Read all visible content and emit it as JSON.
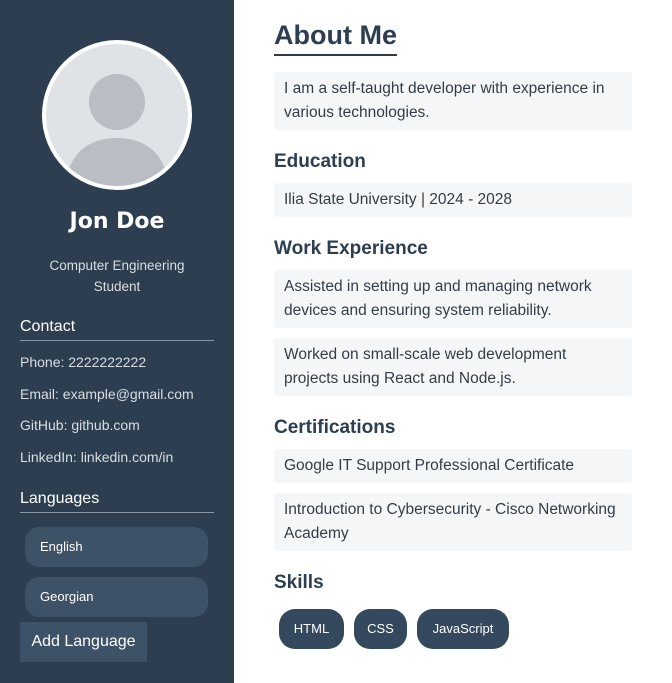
{
  "profile": {
    "name": "Jon Doe",
    "role": "Computer Engineering Student"
  },
  "contact": {
    "heading": "Contact",
    "phone": "Phone: 2222222222",
    "email": "Email: example@gmail.com",
    "github": "GitHub: github.com",
    "linkedin": "LinkedIn: linkedin.com/in"
  },
  "languages": {
    "heading": "Languages",
    "items": [
      "English",
      "Georgian"
    ],
    "add_label": "Add Language"
  },
  "about": {
    "title": "About Me",
    "text": "I am a self-taught developer with experience in various technologies."
  },
  "education": {
    "title": "Education",
    "items": [
      "Ilia State University | 2024 - 2028"
    ]
  },
  "work": {
    "title": "Work Experience",
    "items": [
      "Assisted in setting up and managing network devices and ensuring system reliability.",
      "Worked on small-scale web development projects using React and Node.js."
    ]
  },
  "certifications": {
    "title": "Certifications",
    "items": [
      "Google IT Support Professional Certificate",
      "Introduction to Cybersecurity - Cisco Networking Academy"
    ]
  },
  "skills": {
    "title": "Skills",
    "items": [
      "HTML",
      "CSS",
      "JavaScript"
    ]
  },
  "colors": {
    "sidebar_bg": "#2c3e50",
    "accent": "#34495e",
    "box_bg": "#f5f6f7"
  },
  "icons": {
    "avatar": "user-silhouette-icon"
  }
}
